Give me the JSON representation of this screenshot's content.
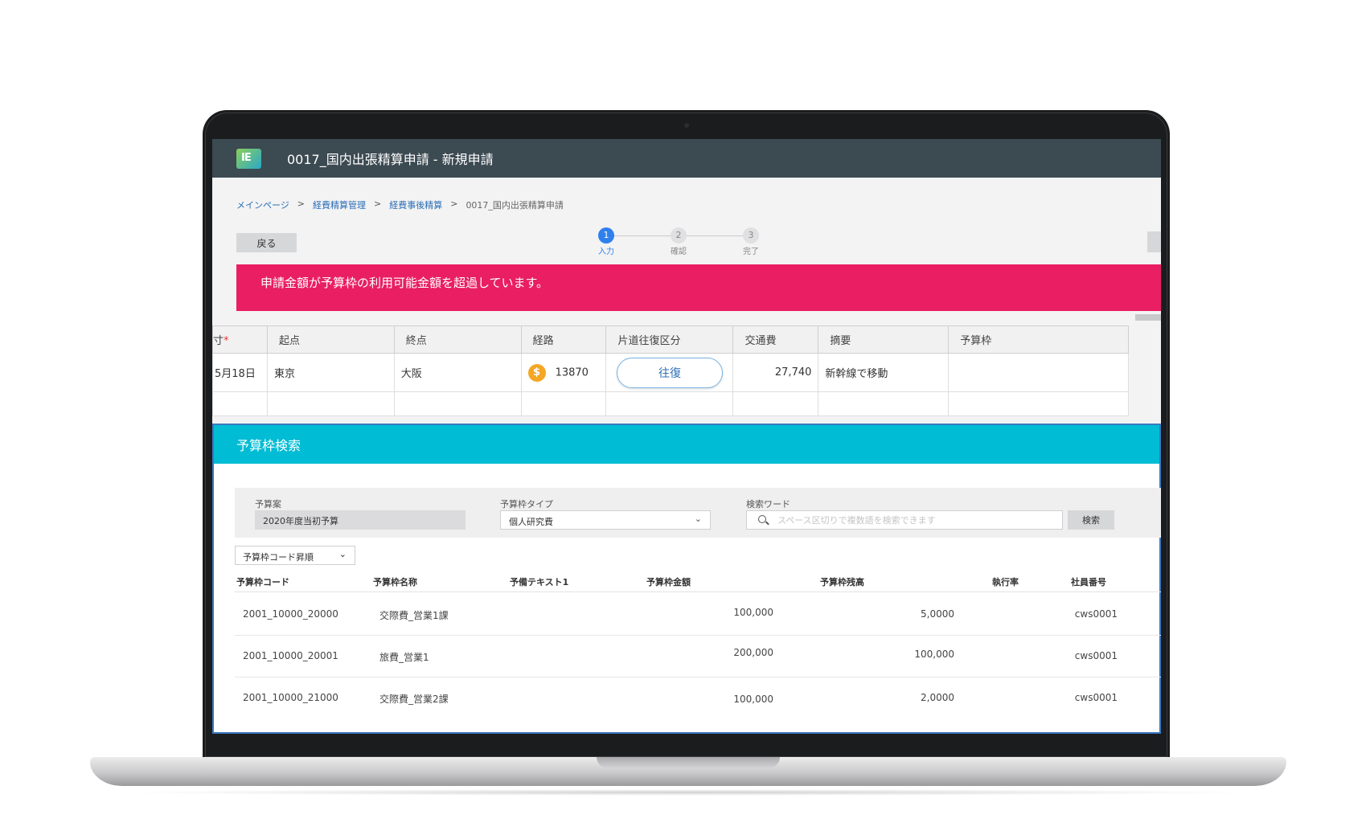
{
  "header": {
    "title": "0017_国内出張精算申請 - 新規申請"
  },
  "breadcrumb": {
    "items": [
      "メインページ",
      "経費精算管理",
      "経費事後精算"
    ],
    "current": "0017_国内出張精算申請",
    "separator": ">"
  },
  "back_label": "戻る",
  "stepper": {
    "steps": [
      {
        "num": "1",
        "label": "入力",
        "active": true
      },
      {
        "num": "2",
        "label": "確認",
        "active": false
      },
      {
        "num": "3",
        "label": "完了",
        "active": false
      }
    ]
  },
  "alert": {
    "message": "申請金額が予算枠の利用可能金額を超過しています。",
    "color": "#e91e63"
  },
  "transport_table": {
    "headers": [
      "寸",
      "起点",
      "終点",
      "経路",
      "片道往復区分",
      "交通費",
      "摘要",
      "予算枠"
    ],
    "required_mark": "*",
    "row": {
      "date": "5月18日",
      "from": "東京",
      "to": "大阪",
      "route_coin": "$",
      "route_value": "13870",
      "trip_type": "往復",
      "fare": "27,740",
      "memo": "新幹線で移動",
      "budget": ""
    }
  },
  "modal": {
    "title": "予算枠検索",
    "header_color": "#00bcd4",
    "filters": {
      "budget_plan_label": "予算案",
      "budget_plan_value": "2020年度当初予算",
      "budget_type_label": "予算枠タイプ",
      "budget_type_value": "個人研究費",
      "search_label": "検索ワード",
      "search_placeholder": "スペース区切りで複数語を検索できます",
      "search_button": "検索"
    },
    "sort_label": "予算枠コード昇順",
    "columns": [
      "予算枠コード",
      "予算枠名称",
      "予備テキスト1",
      "予算枠金額",
      "予算枠残高",
      "執行率",
      "社員番号"
    ],
    "rows": [
      {
        "code": "2001_10000_20000",
        "name": "交際費_営業1課",
        "text1": "",
        "amount": "100,000",
        "balance": "5,0000",
        "rate": "",
        "employee": "cws0001"
      },
      {
        "code": "2001_10000_20001",
        "name": "旅費_営業1",
        "text1": "",
        "amount": "200,000",
        "balance": "100,000",
        "rate": "",
        "employee": "cws0001"
      },
      {
        "code": "2001_10000_21000",
        "name": "交際費_営業2課",
        "text1": "",
        "amount": "100,000",
        "balance": "2,0000",
        "rate": "",
        "employee": "cws0001"
      }
    ]
  }
}
